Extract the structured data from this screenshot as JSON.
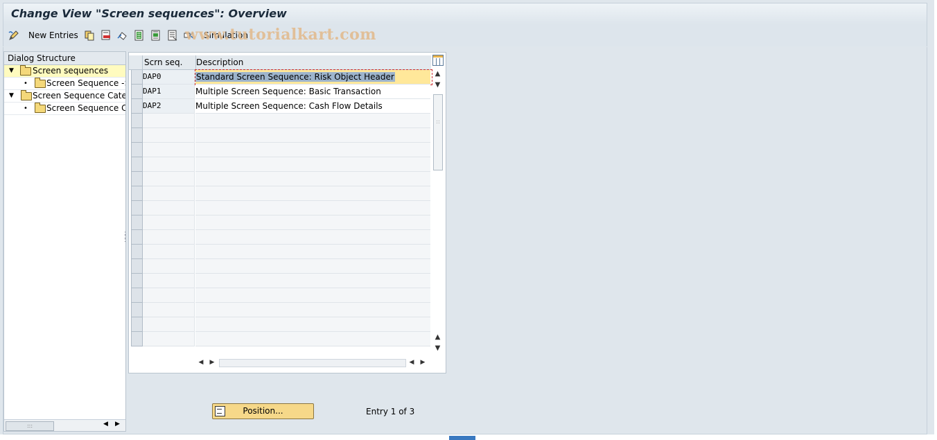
{
  "window": {
    "title": "Change View \"Screen sequences\": Overview"
  },
  "toolbar": {
    "items": [
      {
        "icon": "display-change-icon",
        "label": ""
      },
      {
        "icon": "new-entries-icon",
        "label": "New Entries"
      },
      {
        "icon": "copy-icon",
        "label": ""
      },
      {
        "icon": "delete-icon",
        "label": ""
      },
      {
        "icon": "undo-icon",
        "label": ""
      },
      {
        "icon": "select-all-icon",
        "label": ""
      },
      {
        "icon": "select-block-icon",
        "label": ""
      },
      {
        "icon": "deselect-all-icon",
        "label": ""
      },
      {
        "icon": "simulation-icon",
        "label": "Simulation"
      }
    ],
    "watermark": "www.tutorialkart.com"
  },
  "dialog_structure": {
    "header": "Dialog Structure",
    "items": [
      {
        "label": "Screen sequences",
        "expanded": true,
        "selected": true
      },
      {
        "label": "Screen Sequence ->",
        "child": true
      },
      {
        "label": "Screen Sequence Categ",
        "expanded": true
      },
      {
        "label": "Screen Sequence Ca",
        "child": true
      }
    ]
  },
  "table": {
    "columns": [
      "Scrn seq.",
      "Description"
    ],
    "rows": [
      {
        "seq": "DAP0",
        "description": "Standard Screen Sequence: Risk Object Header"
      },
      {
        "seq": "DAP1",
        "description": "Multiple Screen Sequence: Basic Transaction"
      },
      {
        "seq": "DAP2",
        "description": "Multiple Screen Sequence:  Cash Flow Details"
      }
    ],
    "empty_rows": 16
  },
  "footer": {
    "position_label": "Position...",
    "entry_info": "Entry 1 of 3"
  },
  "colors": {
    "accent_yellow": "#f6d889",
    "selection_yellow": "#fffbbf",
    "highlight_blue": "#9db4cc"
  }
}
